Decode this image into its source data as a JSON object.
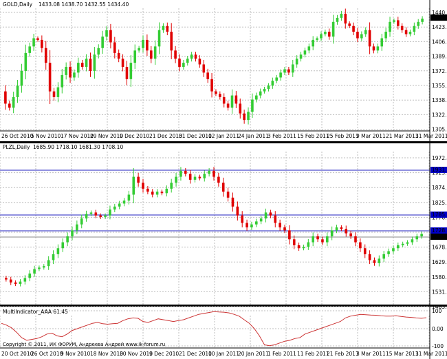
{
  "panels": {
    "gold": {
      "title": "GOLD,Daily",
      "ohlc_text": "1433.08 1438.70 1432.55 1434.40",
      "price_labels": [
        "1440.70",
        "1423.70",
        "1406.70",
        "1389.70",
        "1372.70",
        "1355.70",
        "1338.70",
        "1322.20",
        "1305.20"
      ],
      "last_price": "1434.40",
      "date_labels": [
        "26 Oct 2010",
        "5 Nov 2010",
        "17 Nov 2010",
        "29 Nov 2010",
        "9 Dec 2010",
        "21 Dec 2010",
        "31 Dec 2010",
        "12 Jan 2011",
        "24 Jan 2011",
        "3 Feb 2011",
        "15 Feb 2011",
        "25 Feb 2011",
        "9 Mar 2011",
        "21 Mar 2011",
        "31 Mar 2011"
      ]
    },
    "plzl": {
      "title": "PLZL,Daily",
      "ohlc_text": "1685.90 1718.10 1681.30 1708.10",
      "price_labels": [
        "1972.40",
        "1923.20",
        "1874.00",
        "1825.05",
        "1776.05",
        "1727.05",
        "1678.05",
        "1629.05",
        "1580.05",
        "1531.05",
        "1483.40"
      ],
      "level_labels": [
        "1931.22",
        "1785.09",
        "1728.60"
      ],
      "last_price": "1708.10"
    },
    "indicator": {
      "title": "MultiIndicator_AAA 61.45",
      "axis_labels": [
        "100",
        "0.00",
        "-100"
      ],
      "copyright": "Copyright © 2011, ИК ФОРУМ, Андреева Андрей www.ik-forum.ru",
      "date_labels": [
        "20 Oct 2010",
        "26 Oct 2010",
        "9 Nov 2010",
        "18 Nov 2010",
        "30 Nov 2010",
        "9 Dec 2010",
        "21 Dec 2010",
        "10 Jan 2011",
        "20 Jan 2011",
        "1 Feb 2011",
        "11 Feb 2011",
        "21 Feb 2011",
        "3 Mar 2011",
        "15 Mar 2011",
        "31 Mar 2011"
      ]
    }
  },
  "colors": {
    "bull": "#33cc33",
    "bear": "#e00000",
    "grid": "#bdbdbd",
    "level": "#2020c0",
    "indicator": "#cc3333",
    "highlight_label": "#0000c8"
  },
  "gold_series": [
    1345,
    1330,
    1325,
    1338,
    1352,
    1370,
    1392,
    1400,
    1410,
    1408,
    1398,
    1380,
    1345,
    1338,
    1350,
    1365,
    1375,
    1362,
    1368,
    1380,
    1375,
    1385,
    1370,
    1390,
    1398,
    1412,
    1420,
    1405,
    1392,
    1385,
    1375,
    1360,
    1380,
    1395,
    1398,
    1408,
    1395,
    1385,
    1400,
    1420,
    1425,
    1418,
    1395,
    1385,
    1375,
    1380,
    1385,
    1390,
    1385,
    1378,
    1368,
    1360,
    1345,
    1342,
    1338,
    1330,
    1325,
    1340,
    1330,
    1318,
    1310,
    1320,
    1335,
    1340,
    1345,
    1348,
    1352,
    1358,
    1362,
    1368,
    1372,
    1368,
    1378,
    1385,
    1390,
    1395,
    1400,
    1408,
    1410,
    1415,
    1418,
    1412,
    1430,
    1435,
    1440,
    1428,
    1425,
    1418,
    1410,
    1415,
    1420,
    1400,
    1395,
    1400,
    1410,
    1418,
    1430,
    1432,
    1425,
    1420,
    1415,
    1418,
    1425,
    1430,
    1434
  ],
  "plzl_series": [
    1560,
    1555,
    1545,
    1540,
    1548,
    1560,
    1575,
    1590,
    1595,
    1600,
    1620,
    1640,
    1660,
    1680,
    1700,
    1720,
    1740,
    1760,
    1775,
    1780,
    1770,
    1765,
    1770,
    1790,
    1800,
    1810,
    1820,
    1840,
    1900,
    1880,
    1860,
    1850,
    1840,
    1850,
    1845,
    1860,
    1880,
    1900,
    1920,
    1910,
    1890,
    1900,
    1895,
    1910,
    1920,
    1900,
    1880,
    1850,
    1830,
    1800,
    1770,
    1745,
    1730,
    1740,
    1750,
    1760,
    1780,
    1770,
    1745,
    1730,
    1720,
    1690,
    1670,
    1660,
    1665,
    1680,
    1700,
    1690,
    1680,
    1700,
    1720,
    1730,
    1725,
    1710,
    1700,
    1680,
    1660,
    1640,
    1620,
    1610,
    1625,
    1640,
    1650,
    1660,
    1670,
    1675,
    1680,
    1690,
    1700,
    1708
  ],
  "indicator_series": [
    30,
    20,
    5,
    -20,
    -50,
    -65,
    -60,
    -55,
    -45,
    -30,
    -25,
    -40,
    -45,
    -30,
    -10,
    0,
    10,
    20,
    30,
    35,
    28,
    25,
    28,
    30,
    45,
    55,
    60,
    58,
    40,
    35,
    45,
    55,
    50,
    45,
    40,
    45,
    50,
    60,
    70,
    80,
    85,
    90,
    95,
    93,
    92,
    88,
    80,
    70,
    50,
    30,
    0,
    -40,
    -90,
    -95,
    -90,
    -80,
    -70,
    -65,
    -55,
    -50,
    -30,
    -20,
    -10,
    0,
    10,
    20,
    30,
    40,
    60,
    70,
    75,
    80,
    78,
    76,
    75,
    72,
    70,
    70,
    72,
    68,
    65,
    63,
    60,
    58,
    61
  ]
}
